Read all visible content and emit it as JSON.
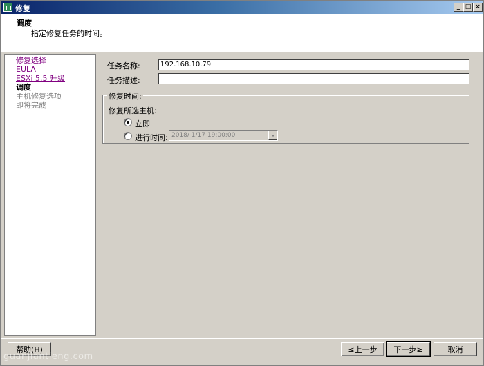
{
  "window": {
    "title": "修复",
    "min_glyph": "_",
    "max_glyph": "□",
    "close_glyph": "×"
  },
  "header": {
    "title": "调度",
    "description": "指定修复任务的时间。"
  },
  "nav": {
    "items": [
      {
        "label": "修复选择",
        "state": "link"
      },
      {
        "label": "EULA",
        "state": "link"
      },
      {
        "label": "ESXi 5.5 升级",
        "state": "link"
      },
      {
        "label": "调度",
        "state": "current"
      },
      {
        "label": "主机修复选项",
        "state": "disabled"
      },
      {
        "label": "即将完成",
        "state": "disabled"
      }
    ]
  },
  "form": {
    "task_name_label": "任务名称:",
    "task_name_value": "192.168.10.79",
    "task_desc_label": "任务描述:",
    "task_desc_value": "",
    "group_title": "修复时间:",
    "remediate_label": "修复所选主机:",
    "immediately_label": "立即",
    "scheduled_label": "进行时间:",
    "scheduled_value": "2018/  1/17 19:00:00",
    "selected_option": "immediately"
  },
  "buttons": {
    "help": "帮助(H)",
    "back": "≤上一步",
    "next": "下一步≥",
    "cancel": "取消"
  },
  "watermark": "guanjiantieng.com",
  "colors": {
    "link": "#800080",
    "titlebar_start": "#0a246a",
    "face": "#d4d0c8"
  }
}
